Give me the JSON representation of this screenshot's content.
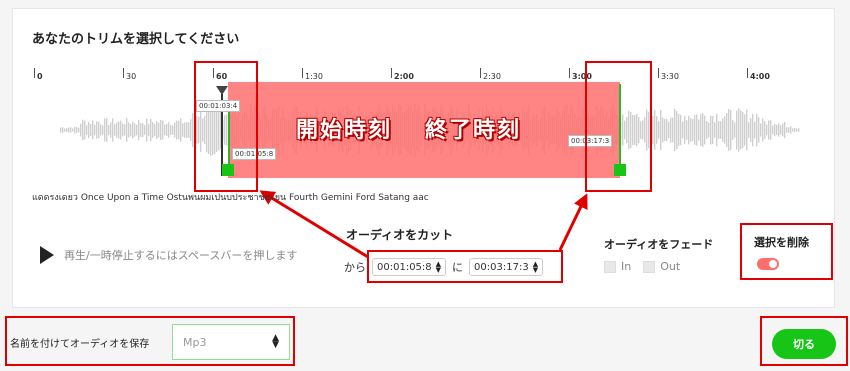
{
  "title": "あなたのトリムを選択してください",
  "ruler": {
    "labels": [
      {
        "text": "0",
        "bold": true
      },
      {
        "text": "30",
        "bold": false
      },
      {
        "text": "60",
        "bold": true
      },
      {
        "text": "1:30",
        "bold": false
      },
      {
        "text": "2:00",
        "bold": true
      },
      {
        "text": "2:30",
        "bold": false
      },
      {
        "text": "3:00",
        "bold": true
      },
      {
        "text": "3:30",
        "bold": false
      },
      {
        "text": "4:00",
        "bold": true
      }
    ]
  },
  "handles": {
    "start_top_time": "00:01:03:4",
    "start_time": "00:01:05:8",
    "end_time": "00:03:17:3"
  },
  "annotation": {
    "start_label": "開始時刻",
    "end_label": "終了時刻"
  },
  "filename": "แดดรงเดยว Once Upon a Time Ostนพนผมเปนบประชาช่ยะยน Fourth Gemini Ford Satang aac",
  "play_hint": "再生/一時停止するにはスペースバーを押します",
  "cut": {
    "title": "オーディオをカット",
    "from_label": "から",
    "from_value": "00:01:05:8",
    "to_label": "に",
    "to_value": "00:03:17:3"
  },
  "fade": {
    "title": "オーディオをフェード",
    "in_label": "In",
    "out_label": "Out"
  },
  "delete_selection": {
    "title": "選択を削除",
    "enabled": true
  },
  "save": {
    "label": "名前を付けてオーディオを保存",
    "format_value": "Mp3"
  },
  "cut_button": "切る",
  "colors": {
    "accent_green": "#16c516",
    "selection_red": "#ff6e6e",
    "annotation_red": "#e00000"
  },
  "icons": [
    "play-icon",
    "spinner-icon",
    "select-caret-icon"
  ]
}
